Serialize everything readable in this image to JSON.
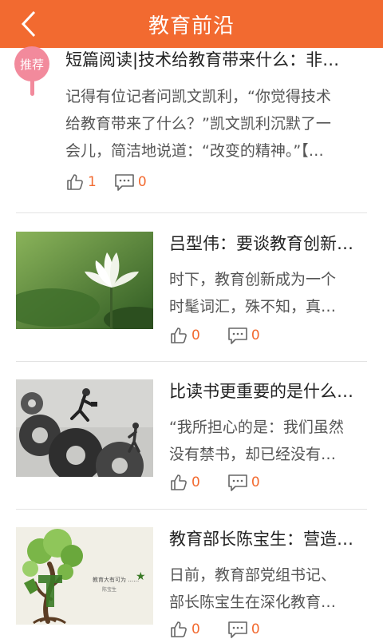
{
  "header": {
    "title": "教育前沿"
  },
  "featured": {
    "badge": "推荐",
    "title": "短篇阅读|技术给教育带来什么：非…",
    "summary_line1": "记得有位记者问凯文凯利，“你觉得技术",
    "summary_line2": "给教育带来了什么？”凯文凯利沉默了一",
    "summary_line3": "会儿，简洁地说道：“改变的精神。”【…",
    "likes": "1",
    "comments": "0"
  },
  "articles": [
    {
      "title": "吕型伟：要谈教育创新…",
      "line1": "时下，教育创新成为一个",
      "line2": "时髦词汇，殊不知，真…",
      "likes": "0",
      "comments": "0",
      "thumb": "lotus-photo"
    },
    {
      "title": "比读书更重要的是什么…",
      "line1": "“我所担心的是：我们虽然",
      "line2": "没有禁书，却已经没有…",
      "likes": "0",
      "comments": "0",
      "thumb": "gears-photo"
    },
    {
      "title": "教育部长陈宝生：营造…",
      "line1": "日前，教育部党组书记、",
      "line2": "部长陈宝生在深化教育…",
      "likes": "0",
      "comments": "0",
      "thumb": "tree-calligraphy-photo"
    }
  ],
  "colors": {
    "accent": "#f26a30",
    "badge": "#f28a9c"
  }
}
